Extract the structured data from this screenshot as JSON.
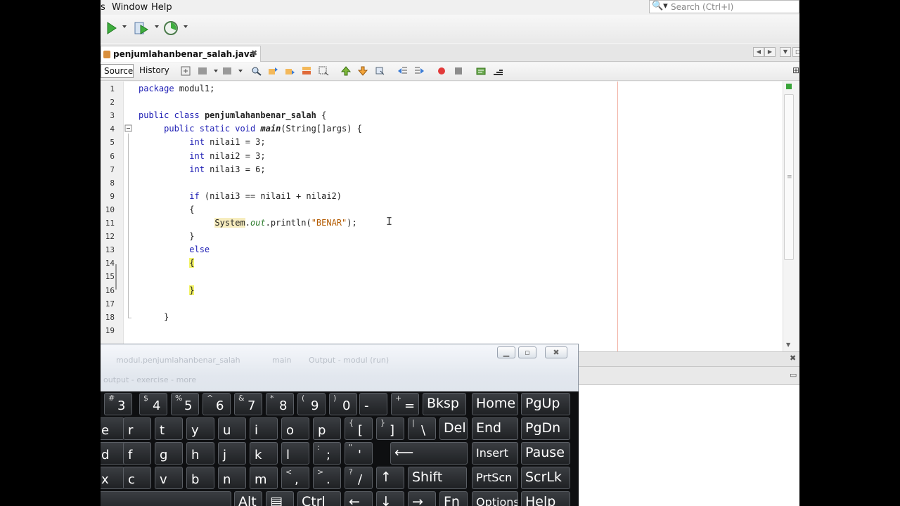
{
  "menu": {
    "items": [
      "s",
      "Window",
      "Help"
    ]
  },
  "search": {
    "placeholder": "Search (Ctrl+I)"
  },
  "editor": {
    "tab": "penjumlahanbenar_salah.java",
    "source_label": "Source",
    "history_label": "History",
    "code_lines": [
      {
        "n": "1",
        "html": "<span class='kw'>package</span> modul1;"
      },
      {
        "n": "2",
        "html": ""
      },
      {
        "n": "3",
        "html": "<span class='kw'>public class</span> <span class='bold'>penjumlahanbenar_salah</span> {"
      },
      {
        "n": "4",
        "html": "     <span class='kw'>public static void</span> <span class='bold' style='font-style:italic'>main</span>(String[]args) {"
      },
      {
        "n": "5",
        "html": "          <span class='kw'>int</span> nilai1 = 3;"
      },
      {
        "n": "6",
        "html": "          <span class='kw'>int</span> nilai2 = 3;"
      },
      {
        "n": "7",
        "html": "          <span class='kw'>int</span> nilai3 = 6;"
      },
      {
        "n": "8",
        "html": ""
      },
      {
        "n": "9",
        "html": "          <span class='kw'>if</span> (nilai3 == nilai1 + nilai2)"
      },
      {
        "n": "10",
        "html": "          {"
      },
      {
        "n": "11",
        "html": "               <span class='hl-gold'>System</span>.<span class='it'>out</span>.println(<span class='str'>\"BENAR\"</span>);"
      },
      {
        "n": "12",
        "html": "          }"
      },
      {
        "n": "13",
        "html": "          <span class='kw'>else</span>"
      },
      {
        "n": "14",
        "html": "          <span class='hl-yellow'>{</span>"
      },
      {
        "n": "15",
        "html": ""
      },
      {
        "n": "16",
        "html": "          <span class='hl-yellow'>}</span>"
      },
      {
        "n": "17",
        "html": ""
      },
      {
        "n": "18",
        "html": "     }"
      },
      {
        "n": "19",
        "html": ""
      }
    ]
  },
  "keyboard": {
    "blur_line1": "modul.penjumlahanbenar_salah",
    "blur_line2": "main",
    "blur_line3": "Output - modul (run)",
    "blur_line4": "output - exercise - more",
    "rows": [
      [
        {
          "t": "#",
          "m": "3"
        },
        {
          "t": "$",
          "m": "4"
        },
        {
          "t": "%",
          "m": "5"
        },
        {
          "t": "^",
          "m": "6"
        },
        {
          "t": "&",
          "m": "7"
        },
        {
          "t": "*",
          "m": "8"
        },
        {
          "t": "(",
          "m": "9"
        },
        {
          "t": ")",
          "m": "0"
        },
        {
          "t": "",
          "m": "-"
        },
        {
          "t": "+",
          "m": "="
        },
        {
          "w": "Bksp"
        },
        {
          "w": "Home"
        },
        {
          "w": "PgUp"
        }
      ],
      [
        {
          "m": "e"
        },
        {
          "m": "r"
        },
        {
          "m": "t"
        },
        {
          "m": "y"
        },
        {
          "m": "u"
        },
        {
          "m": "i"
        },
        {
          "m": "o"
        },
        {
          "m": "p"
        },
        {
          "t": "{",
          "m": "["
        },
        {
          "t": "}",
          "m": "]"
        },
        {
          "t": "|",
          "m": "\\"
        },
        {
          "w": "Del"
        },
        {
          "w": "End"
        },
        {
          "w": "PgDn"
        }
      ],
      [
        {
          "m": "d"
        },
        {
          "m": "f"
        },
        {
          "m": "g"
        },
        {
          "m": "h"
        },
        {
          "m": "j"
        },
        {
          "m": "k"
        },
        {
          "m": "l"
        },
        {
          "t": ":",
          "m": ";"
        },
        {
          "t": "\"",
          "m": "'"
        },
        {
          "w": "⟵"
        },
        {
          "w": "Insert"
        },
        {
          "w": "Pause"
        }
      ],
      [
        {
          "m": "x"
        },
        {
          "m": "c"
        },
        {
          "m": "v"
        },
        {
          "m": "b"
        },
        {
          "m": "n"
        },
        {
          "m": "m"
        },
        {
          "t": "<",
          "m": ","
        },
        {
          "t": ">",
          "m": "."
        },
        {
          "t": "?",
          "m": "/"
        },
        {
          "w": "↑"
        },
        {
          "w": "Shift"
        },
        {
          "w": "PrtScn"
        },
        {
          "w": "ScrLk"
        }
      ],
      [
        {
          "w": ""
        },
        {
          "w": "Alt"
        },
        {
          "w": "▤"
        },
        {
          "w": "Ctrl"
        },
        {
          "w": "←"
        },
        {
          "w": "↓"
        },
        {
          "w": "→"
        },
        {
          "w": "Fn"
        },
        {
          "w": "Options"
        },
        {
          "w": "Help"
        }
      ]
    ]
  },
  "colors": {
    "keyword": "#1b1bb3",
    "brace_highlight": "#f3f36a",
    "key_bg": "#1f2124"
  }
}
